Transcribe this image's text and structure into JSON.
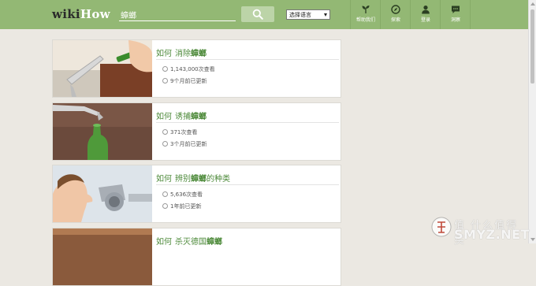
{
  "header": {
    "logo_part1": "wiki",
    "logo_part2": "How",
    "search_value": "蟑螂",
    "language_select": "选择语言",
    "nav": [
      {
        "icon": "sprout-icon",
        "label": "帮助我们"
      },
      {
        "icon": "compass-icon",
        "label": "探索"
      },
      {
        "icon": "user-icon",
        "label": "登录"
      },
      {
        "icon": "chat-icon",
        "label": "洞察"
      }
    ]
  },
  "results": [
    {
      "prefix": "如何",
      "before": "消除",
      "keyword": "蟑螂",
      "after": "",
      "views": "1,143,000次查看",
      "updated": "9个月前已更新"
    },
    {
      "prefix": "如何",
      "before": "诱捕",
      "keyword": "蟑螂",
      "after": "",
      "views": "371次查看",
      "updated": "3个月前已更新"
    },
    {
      "prefix": "如何",
      "before": "辨别",
      "keyword": "蟑螂",
      "after": "的种类",
      "views": "5,636次查看",
      "updated": "1年前已更新"
    },
    {
      "prefix": "如何",
      "before": "杀灭德国",
      "keyword": "蟑螂",
      "after": ""
    }
  ],
  "watermark": {
    "line1": "值 什么值得买",
    "line2": "SMYZ.NET"
  },
  "colors": {
    "header": "#93b874",
    "accent": "#4d8a3a",
    "background": "#ebe8e2"
  }
}
